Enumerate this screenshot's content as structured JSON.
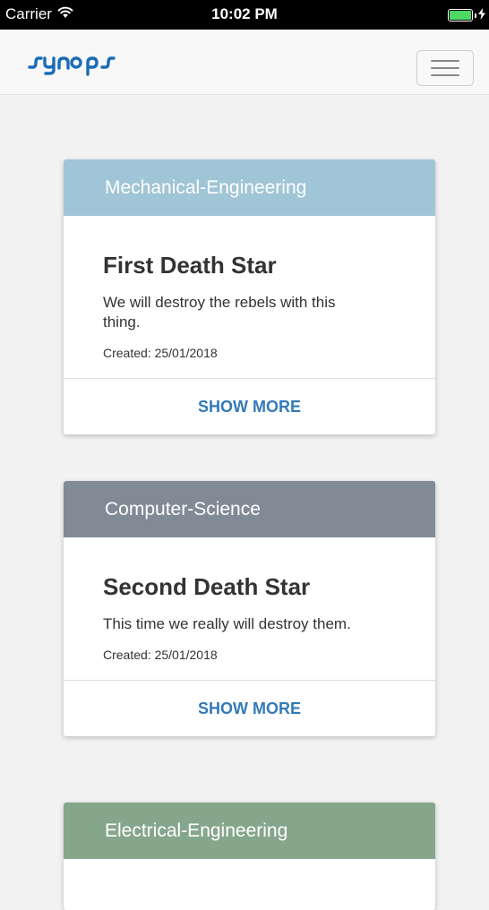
{
  "status_bar": {
    "carrier": "Carrier",
    "time": "10:02 PM"
  },
  "navbar": {
    "brand": "synaps",
    "brand_color": "#1a6bb5",
    "menu_icon": "hamburger-icon"
  },
  "cards": [
    {
      "category": "Mechanical-Engineering",
      "header_color": "#a0c5d6",
      "title": "First Death Star",
      "description": "We will destroy the rebels with this thing.",
      "created": "Created: 25/01/2018",
      "action_label": "SHOW MORE"
    },
    {
      "category": "Computer-Science",
      "header_color": "#808b96",
      "title": "Second Death Star",
      "description": "This time we really will destroy them.",
      "created": "Created: 25/01/2018",
      "action_label": "SHOW MORE"
    },
    {
      "category": "Electrical-Engineering",
      "header_color": "#86a68b"
    }
  ],
  "colors": {
    "link": "#337ab7",
    "page_background": "#f2f2f2",
    "battery": "#4cd964"
  }
}
